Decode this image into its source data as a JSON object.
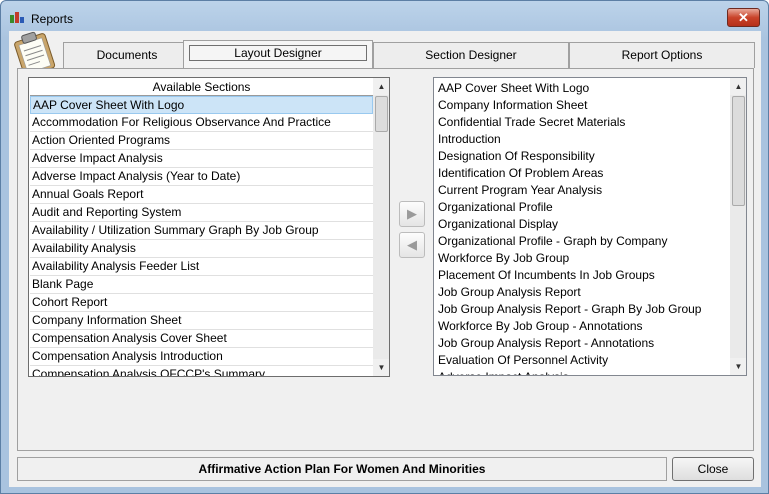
{
  "window": {
    "title": "Reports",
    "close_glyph": "✕",
    "app_icon": "reports-icon"
  },
  "tabs": [
    {
      "label": "Documents",
      "active": false
    },
    {
      "label": "Layout Designer",
      "active": true
    },
    {
      "label": "Section Designer",
      "active": false
    },
    {
      "label": "Report Options",
      "active": false
    }
  ],
  "available_sections": {
    "header": "Available Sections",
    "selected_index": 0,
    "items": [
      "AAP Cover Sheet With Logo",
      "Accommodation For Religious Observance And Practice",
      "Action Oriented Programs",
      "Adverse Impact Analysis",
      "Adverse Impact Analysis (Year to Date)",
      "Annual Goals Report",
      "Audit and Reporting System",
      "Availability / Utilization Summary Graph By Job Group",
      "Availability Analysis",
      "Availability Analysis Feeder List",
      "Blank Page",
      "Cohort Report",
      "Company Information Sheet",
      "Compensation Analysis Cover Sheet",
      "Compensation Analysis Introduction",
      "Compensation Analysis OFCCP's Summary"
    ]
  },
  "selected_sections": {
    "items": [
      "AAP Cover Sheet With Logo",
      "Company Information Sheet",
      "Confidential Trade Secret Materials",
      "Introduction",
      "Designation Of Responsibility",
      "Identification Of Problem Areas",
      "Current Program Year Analysis",
      "Organizational Profile",
      "Organizational Display",
      "Organizational Profile  - Graph by Company",
      "Workforce By Job Group",
      "Placement Of Incumbents In Job Groups",
      "Job Group Analysis Report",
      "Job Group Analysis Report  - Graph By Job Group",
      "Workforce By Job Group - Annotations",
      "Job Group Analysis Report - Annotations",
      "Evaluation Of Personnel Activity",
      "Adverse Impact Analysis"
    ]
  },
  "move_buttons": {
    "add_glyph": "▶",
    "remove_glyph": "◀"
  },
  "status": {
    "plan_title": "Affirmative Action Plan For Women And Minorities"
  },
  "footer": {
    "close_label": "Close"
  },
  "colors": {
    "selection": "#cce4f7",
    "title_bar": "#a9c3df",
    "close_button": "#c9432a"
  }
}
